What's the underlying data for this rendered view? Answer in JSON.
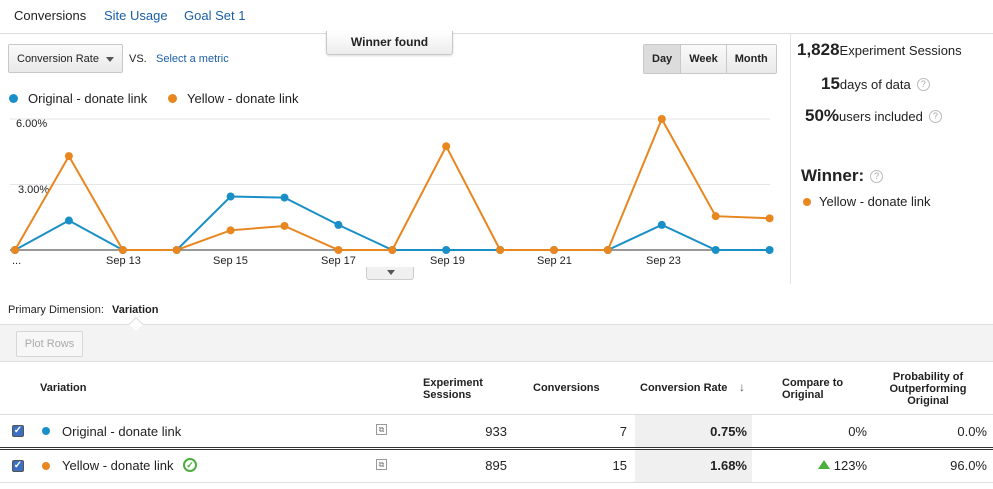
{
  "tabs": {
    "conversions": "Conversions",
    "site_usage": "Site Usage",
    "goal_set": "Goal Set 1"
  },
  "controls": {
    "metric_select": "Conversion Rate",
    "vs": "VS.",
    "select_metric": "Select a metric",
    "winner_banner": "Winner found",
    "range_buttons": [
      "Day",
      "Week",
      "Month"
    ]
  },
  "legend": {
    "original": "Original - donate link",
    "yellow": "Yellow - donate link"
  },
  "colors": {
    "original": "#1a8fc7",
    "yellow": "#e8861f",
    "up": "#4cae3c",
    "link": "#1a5fa5"
  },
  "stats": {
    "sessions_value": "1,828",
    "sessions_label": "Experiment Sessions",
    "days_value": "15",
    "days_label": "days of data",
    "users_value": "50%",
    "users_label": "users included",
    "winner_label": "Winner:",
    "winner_name": "Yellow - donate link"
  },
  "chart_data": {
    "type": "line",
    "ylim": [
      0,
      6
    ],
    "y_ticks": [
      "6.00%",
      "3.00%"
    ],
    "x_tick_labels": [
      "...",
      "Sep 13",
      "Sep 15",
      "Sep 17",
      "Sep 19",
      "Sep 21",
      "Sep 23"
    ],
    "series": [
      {
        "name": "Original - donate link",
        "color": "#1a8fc7",
        "values": [
          0,
          1.35,
          0,
          0,
          2.45,
          2.4,
          1.15,
          0,
          0,
          0,
          0,
          0,
          1.15,
          0,
          0
        ]
      },
      {
        "name": "Yellow - donate link",
        "color": "#e8861f",
        "values": [
          0,
          4.3,
          0,
          0,
          0.9,
          1.1,
          0,
          0,
          4.75,
          0,
          0,
          0,
          6.0,
          1.55,
          1.45
        ]
      }
    ]
  },
  "dimension": {
    "label": "Primary Dimension:",
    "value": "Variation"
  },
  "toolbar": {
    "plot_rows": "Plot Rows"
  },
  "table": {
    "headers": {
      "variation": "Variation",
      "sessions": "Experiment Sessions",
      "conversions": "Conversions",
      "rate": "Conversion Rate",
      "compare": "Compare to Original",
      "prob": "Probability of Outperforming Original"
    },
    "rows": [
      {
        "name": "Original - donate link",
        "sessions": "933",
        "conversions": "7",
        "rate": "0.75%",
        "compare": "0%",
        "prob": "0.0%"
      },
      {
        "name": "Yellow - donate link",
        "sessions": "895",
        "conversions": "15",
        "rate": "1.68%",
        "compare": "123%",
        "prob": "96.0%"
      }
    ]
  }
}
